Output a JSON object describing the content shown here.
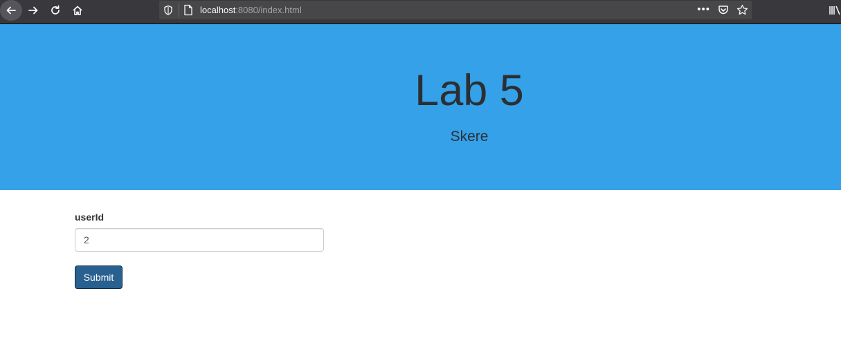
{
  "browser": {
    "url_host": "localhost",
    "url_rest": ":8080/index.html",
    "icons": [
      "back-arrow-icon",
      "forward-arrow-icon",
      "reload-icon",
      "home-icon",
      "shield-icon",
      "page-icon",
      "more-dots-icon",
      "pocket-icon",
      "star-icon",
      "library-icon"
    ],
    "dots": "•••"
  },
  "header": {
    "title": "Lab 5",
    "subtitle": "Skere",
    "background": "#35a1e8"
  },
  "form": {
    "label": "userId",
    "input_value": "2",
    "submit_label": "Submit",
    "button_color": "#286090"
  }
}
